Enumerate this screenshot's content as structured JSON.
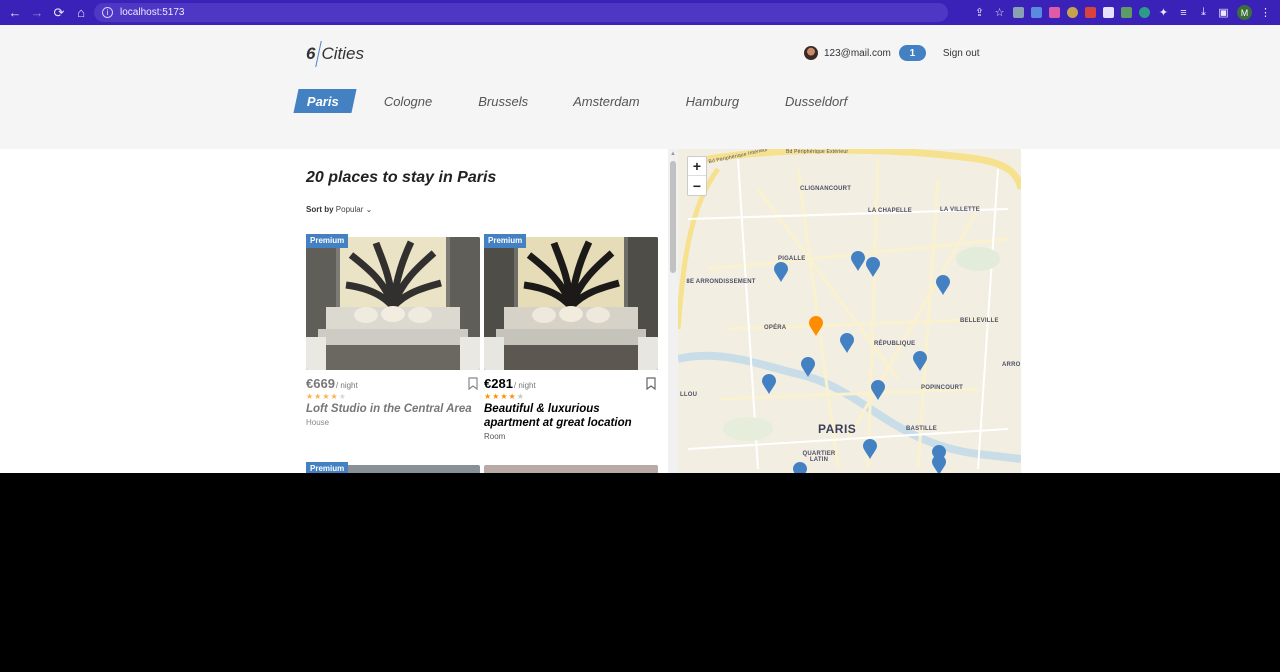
{
  "browser": {
    "url": "localhost:5173",
    "profile_initial": "M",
    "icons": [
      "back-icon",
      "forward-icon",
      "reload-icon",
      "home-icon",
      "info-icon",
      "share-icon",
      "star-icon",
      "extensions-icon",
      "reading-list-icon",
      "download-icon",
      "sidepanel-icon",
      "menu-icon"
    ]
  },
  "header": {
    "logo_number": "6",
    "logo_text": "Cities",
    "email": "123@mail.com",
    "favorites_count": "1",
    "sign_out": "Sign out"
  },
  "cities": [
    "Paris",
    "Cologne",
    "Brussels",
    "Amsterdam",
    "Hamburg",
    "Dusseldorf"
  ],
  "active_city": "Paris",
  "main": {
    "title": "20 places to stay in Paris",
    "sort_label": "Sort by",
    "sort_value": "Popular"
  },
  "offers": [
    {
      "premium": "Premium",
      "price": "€669",
      "per_night": "/ night",
      "rating_stars": 4,
      "name": "Loft Studio in the Central Area",
      "type": "House",
      "hovered": true
    },
    {
      "premium": "Premium",
      "price": "€281",
      "per_night": "/ night",
      "rating_stars": 4,
      "name": "Beautiful & luxurious apartment at great location",
      "type": "Room",
      "hovered": false
    },
    {
      "premium": "Premium"
    },
    {}
  ],
  "map": {
    "zoom_in": "+",
    "zoom_out": "−",
    "labels": [
      "Bd Périphérique Intérieur",
      "Bd Périphérique Extérieur",
      "CLIGNANCOURT",
      "LA CHAPELLE",
      "LA VILLETTE",
      "PIGALLE",
      "8E ARRONDISSEMENT",
      "OPÉRA",
      "RÉPUBLIQUE",
      "BELLEVILLE",
      "POPINCOURT",
      "PARIS",
      "BASTILLE",
      "QUARTIER LATIN",
      "ARRO",
      "LLOU"
    ],
    "pin_color": "#4481c3",
    "active_pin_color": "#ff8c00",
    "pin_count": 14
  },
  "colors": {
    "accent": "#4481c3",
    "browser_bar": "#3a22b8",
    "star": "#ff9000"
  }
}
